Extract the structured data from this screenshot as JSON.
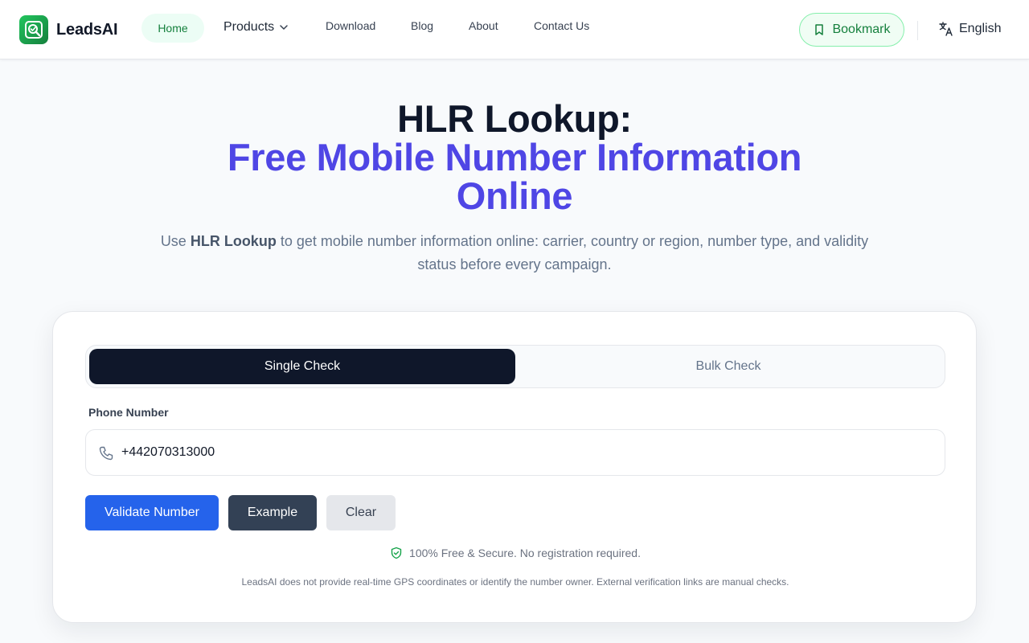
{
  "header": {
    "brand": "LeadsAI",
    "nav": {
      "home": "Home",
      "products": "Products",
      "download": "Download",
      "blog": "Blog",
      "about": "About",
      "contact": "Contact Us"
    },
    "bookmark_label": "Bookmark",
    "language": "English"
  },
  "hero": {
    "title_line1": "HLR Lookup:",
    "title_line2": "Free Mobile Number Information Online",
    "subtitle_prefix": "Use ",
    "subtitle_bold": "HLR Lookup",
    "subtitle_rest": " to get mobile number information online: carrier, country or region, number type, and validity status before every campaign."
  },
  "tool": {
    "tabs": {
      "single": "Single Check",
      "bulk": "Bulk Check"
    },
    "active_tab": "single",
    "phone_label": "Phone Number",
    "phone_value": "+442070313000",
    "buttons": {
      "validate": "Validate Number",
      "example": "Example",
      "clear": "Clear"
    },
    "secure_note": "100% Free & Secure. No registration required.",
    "disclaimer": "LeadsAI does not provide real-time GPS coordinates or identify the number owner. External verification links are manual checks."
  },
  "colors": {
    "brand_green": "#16a34a",
    "accent_indigo": "#4f46e5",
    "primary_blue": "#2563eb",
    "dark": "#0f172a"
  },
  "icons": {
    "logo": "leadsai-logo-icon",
    "products_chevron": "chevron-down-icon",
    "bookmark": "bookmark-icon",
    "language": "translate-icon",
    "phone": "phone-icon",
    "secure": "shield-check-icon"
  }
}
